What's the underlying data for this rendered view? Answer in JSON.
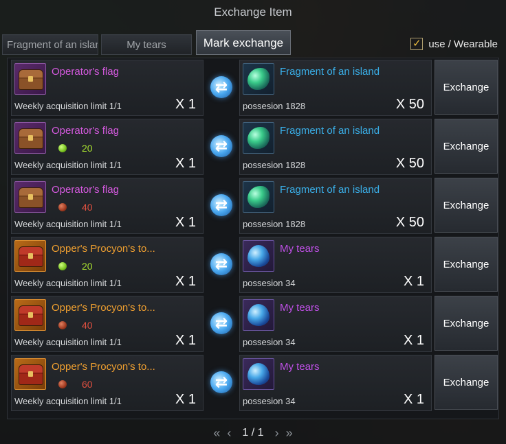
{
  "window": {
    "title": "Exchange Item"
  },
  "tabs": [
    {
      "label": "Fragment of an island"
    },
    {
      "label": "My tears"
    },
    {
      "label": "Mark exchange"
    }
  ],
  "filter": {
    "checked": true,
    "check_mark": "✓",
    "label": "use / Wearable"
  },
  "colors": {
    "violet": "#d65ae0",
    "orange": "#f0a030",
    "cyan": "#3ab0ea",
    "green_price": "#a8e030",
    "red_price": "#e05040"
  },
  "rows": [
    {
      "give": {
        "name": "Operator's flag",
        "price": "",
        "limit": "Weekly acquisition limit 1/1",
        "qty": "X 1"
      },
      "get": {
        "name": "Fragment of an island",
        "possession": "possesion 1828",
        "qty": "X 50"
      },
      "button": "Exchange"
    },
    {
      "give": {
        "name": "Operator's flag",
        "price": "20",
        "limit": "Weekly acquisition limit 1/1",
        "qty": "X 1"
      },
      "get": {
        "name": "Fragment of an island",
        "possession": "possesion 1828",
        "qty": "X 50"
      },
      "button": "Exchange"
    },
    {
      "give": {
        "name": "Operator's flag",
        "price": "40",
        "limit": "Weekly acquisition limit 1/1",
        "qty": "X 1"
      },
      "get": {
        "name": "Fragment of an island",
        "possession": "possesion 1828",
        "qty": "X 50"
      },
      "button": "Exchange"
    },
    {
      "give": {
        "name": "Opper's Procyon's to...",
        "price": "20",
        "limit": "Weekly acquisition limit 1/1",
        "qty": "X 1"
      },
      "get": {
        "name": "My tears",
        "possession": "possesion 34",
        "qty": "X 1"
      },
      "button": "Exchange"
    },
    {
      "give": {
        "name": "Opper's Procyon's to...",
        "price": "40",
        "limit": "Weekly acquisition limit 1/1",
        "qty": "X 1"
      },
      "get": {
        "name": "My tears",
        "possession": "possesion 34",
        "qty": "X 1"
      },
      "button": "Exchange"
    },
    {
      "give": {
        "name": "Opper's Procyon's to...",
        "price": "60",
        "limit": "Weekly acquisition limit 1/1",
        "qty": "X 1"
      },
      "get": {
        "name": "My tears",
        "possession": "possesion 34",
        "qty": "X 1"
      },
      "button": "Exchange"
    }
  ],
  "pager": {
    "first": "«",
    "prev": "‹",
    "page": "1 / 1",
    "next": "›",
    "last": "»"
  }
}
